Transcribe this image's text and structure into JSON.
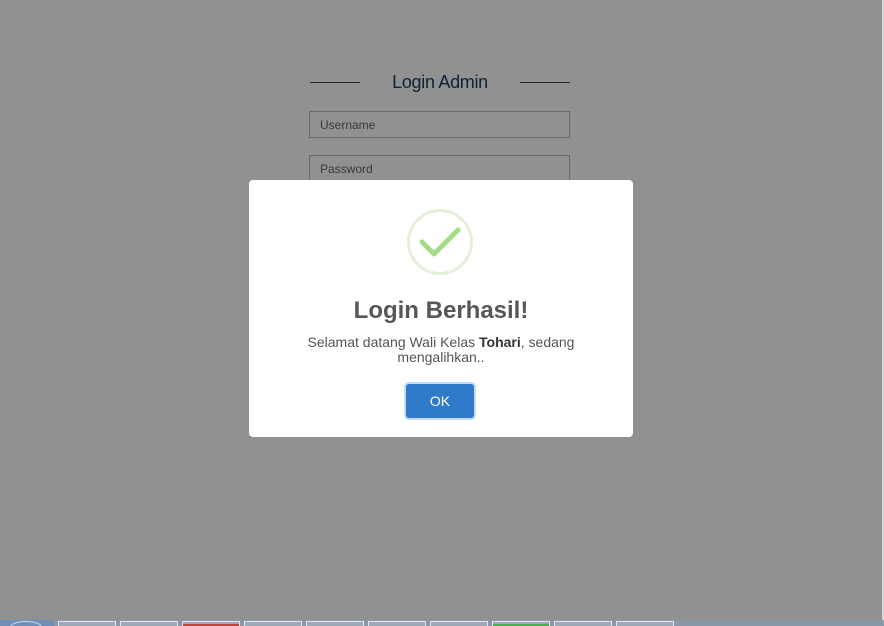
{
  "login_page": {
    "title": "Login Admin",
    "username_placeholder": "Username",
    "password_placeholder": "Password"
  },
  "modal": {
    "icon": "success-check-icon",
    "title": "Login Berhasil!",
    "message_prefix": "Selamat datang Wali Kelas ",
    "message_name": "Tohari",
    "message_suffix": ", sedang mengalihkan..",
    "ok_label": "OK"
  },
  "colors": {
    "success_green": "#a5dc86",
    "ok_button": "#2f7bc9",
    "title_color": "#1b3a5c"
  },
  "taskbar": {
    "items": [
      "start-button",
      "task-1",
      "task-2",
      "task-3",
      "task-4",
      "task-5",
      "task-6",
      "task-7",
      "task-8",
      "task-9",
      "task-10"
    ]
  }
}
